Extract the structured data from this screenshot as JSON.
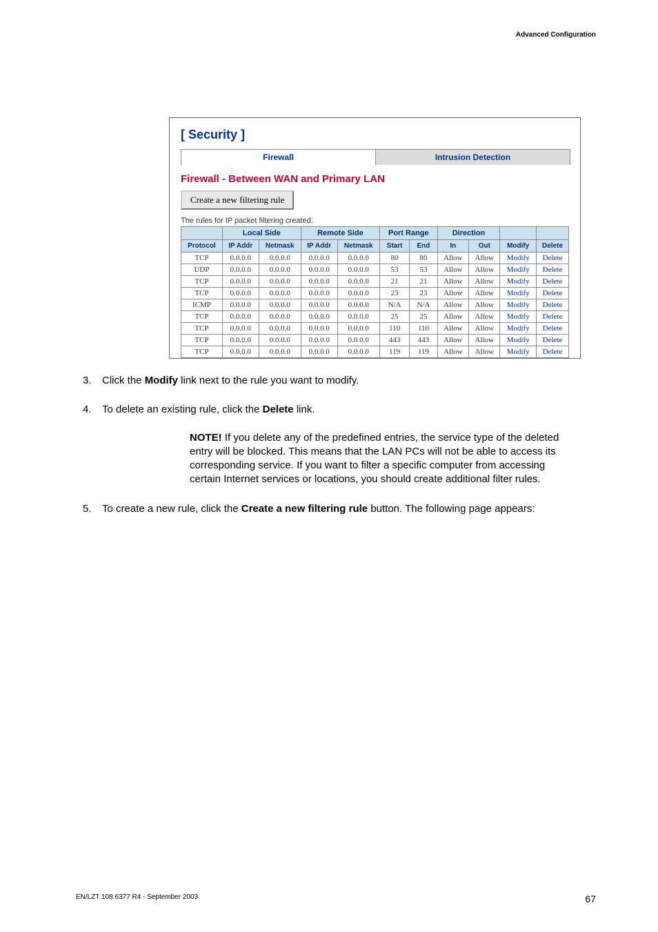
{
  "header": "Advanced Configuration",
  "screenshot": {
    "title": "[ Security ]",
    "tabs": {
      "active": "Firewall",
      "inactive": "Intrusion Detection"
    },
    "subheading": "Firewall - Between WAN and Primary LAN",
    "button": "Create a new filtering rule",
    "rules_text": "The rules for IP packet filtering created:",
    "group_headers": [
      "",
      "Local Side",
      "Remote Side",
      "Port Range",
      "Direction",
      "",
      ""
    ],
    "col_headers": [
      "Protocol",
      "IP Addr",
      "Netmask",
      "IP Addr",
      "Netmask",
      "Start",
      "End",
      "In",
      "Out",
      "Modify",
      "Delete"
    ],
    "rows": [
      [
        "TCP",
        "0.0.0.0",
        "0.0.0.0",
        "0.0.0.0",
        "0.0.0.0",
        "80",
        "80",
        "Allow",
        "Allow",
        "Modify",
        "Delete"
      ],
      [
        "UDP",
        "0.0.0.0",
        "0.0.0.0",
        "0.0.0.0",
        "0.0.0.0",
        "53",
        "53",
        "Allow",
        "Allow",
        "Modify",
        "Delete"
      ],
      [
        "TCP",
        "0.0.0.0",
        "0.0.0.0",
        "0.0.0.0",
        "0.0.0.0",
        "21",
        "21",
        "Allow",
        "Allow",
        "Modify",
        "Delete"
      ],
      [
        "TCP",
        "0.0.0.0",
        "0.0.0.0",
        "0.0.0.0",
        "0.0.0.0",
        "23",
        "23",
        "Allow",
        "Allow",
        "Modify",
        "Delete"
      ],
      [
        "ICMP",
        "0.0.0.0",
        "0.0.0.0",
        "0.0.0.0",
        "0.0.0.0",
        "N/A",
        "N/A",
        "Allow",
        "Allow",
        "Modify",
        "Delete"
      ],
      [
        "TCP",
        "0.0.0.0",
        "0.0.0.0",
        "0.0.0.0",
        "0.0.0.0",
        "25",
        "25",
        "Allow",
        "Allow",
        "Modify",
        "Delete"
      ],
      [
        "TCP",
        "0.0.0.0",
        "0.0.0.0",
        "0.0.0.0",
        "0.0.0.0",
        "110",
        "110",
        "Allow",
        "Allow",
        "Modify",
        "Delete"
      ],
      [
        "TCP",
        "0.0.0.0",
        "0.0.0.0",
        "0.0.0.0",
        "0.0.0.0",
        "443",
        "443",
        "Allow",
        "Allow",
        "Modify",
        "Delete"
      ],
      [
        "TCP",
        "0.0.0.0",
        "0.0.0.0",
        "0.0.0.0",
        "0.0.0.0",
        "119",
        "119",
        "Allow",
        "Allow",
        "Modify",
        "Delete"
      ]
    ]
  },
  "steps": {
    "s3": {
      "num": "3.",
      "pre": "Click the ",
      "bold": "Modify",
      "post": " link next to the rule you want to modify."
    },
    "s4": {
      "num": "4.",
      "pre": "To delete an existing rule, click the ",
      "bold": "Delete",
      "post": " link."
    },
    "s5": {
      "num": "5.",
      "pre": "To create a new rule, click the ",
      "bold": "Create a new filtering rule",
      "post": " button. The following page appears:"
    }
  },
  "note": {
    "bold": "NOTE!",
    "text": " If you delete any of the predefined entries, the service type of the deleted entry will be blocked. This means that the LAN PCs will not be able to access its corresponding service. If you want to filter a specific computer from accessing certain Internet services or locations, you should create additional filter rules."
  },
  "footer": {
    "left": "EN/LZT 108 6377 R4 - September 2003",
    "page": "67"
  }
}
